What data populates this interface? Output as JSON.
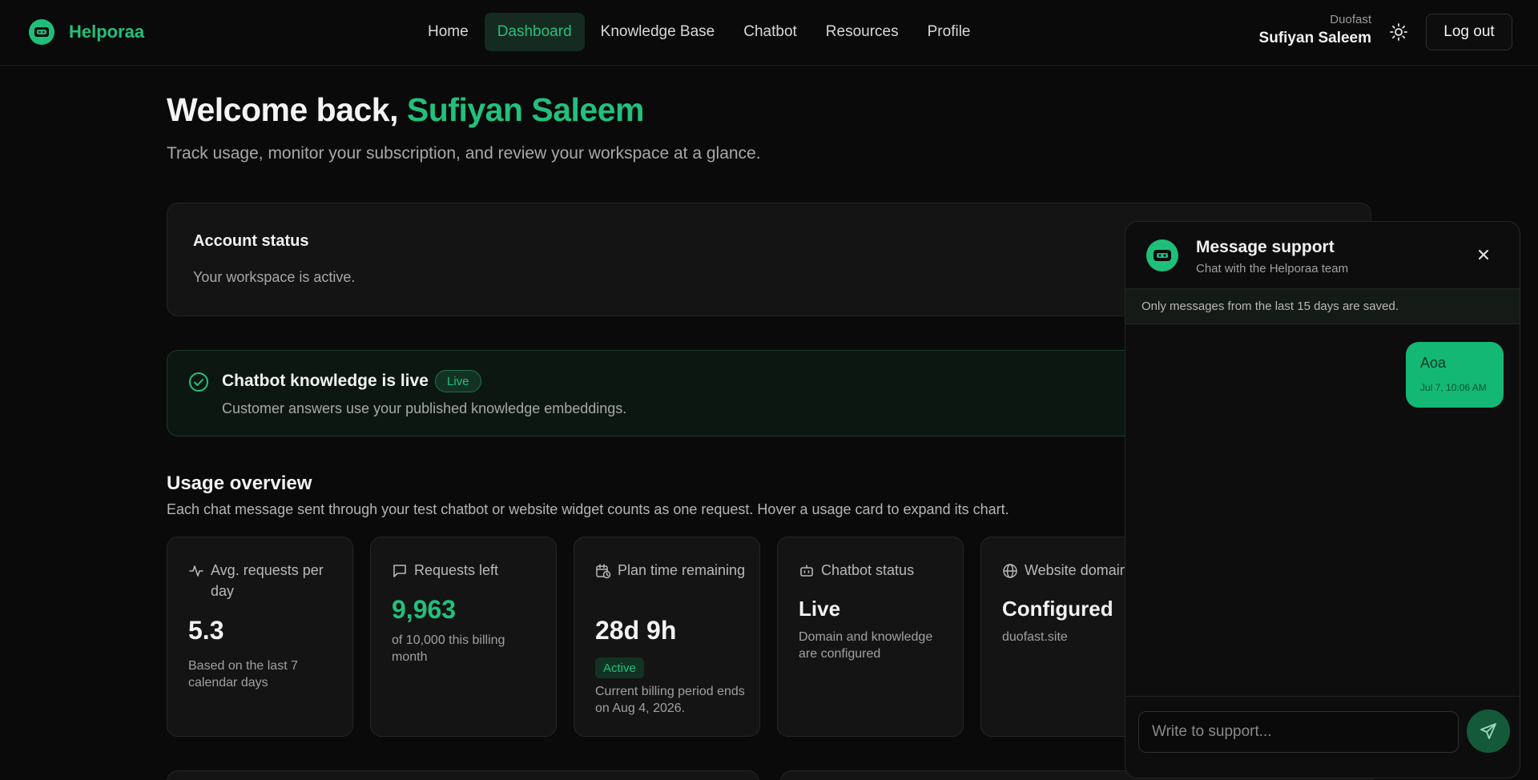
{
  "header": {
    "brand": "Helporaa",
    "nav": [
      {
        "label": "Home",
        "active": false
      },
      {
        "label": "Dashboard",
        "active": true
      },
      {
        "label": "Knowledge Base",
        "active": false
      },
      {
        "label": "Chatbot",
        "active": false
      },
      {
        "label": "Resources",
        "active": false
      },
      {
        "label": "Profile",
        "active": false
      }
    ],
    "org": "Duofast",
    "user_name": "Sufiyan Saleem",
    "theme_icon": "sun-icon",
    "logout_label": "Log out"
  },
  "welcome": {
    "prefix": "Welcome back,",
    "name": "Sufiyan Saleem",
    "subtitle": "Track usage, monitor your subscription, and review your workspace at a glance."
  },
  "account_status": {
    "title": "Account status",
    "description": "Your workspace is active."
  },
  "knowledge": {
    "title": "Chatbot knowledge is live",
    "badge": "Live",
    "description": "Customer answers use your published knowledge embeddings."
  },
  "usage": {
    "title": "Usage overview",
    "description": "Each chat message sent through your test chatbot or website widget counts as one request. Hover a usage card to expand its chart.",
    "cards": [
      {
        "icon": "activity-icon",
        "label": "Avg. requests per day",
        "value": "5.3",
        "sub": "Based on the last 7 calendar days"
      },
      {
        "icon": "message-square-icon",
        "label": "Requests left",
        "value": "9,963",
        "sub": "of 10,000 this billing month"
      },
      {
        "icon": "calendar-clock-icon",
        "label": "Plan time remaining",
        "value": "28d 9h",
        "pill": "Active",
        "sub": "Current billing period ends on Aug 4, 2026."
      },
      {
        "icon": "bot-icon",
        "label": "Chatbot status",
        "value": "Live",
        "sub": "Domain and knowledge are configured"
      },
      {
        "icon": "globe-icon",
        "label": "Website domain",
        "value": "Configured",
        "sub": "duofast.site"
      }
    ]
  },
  "support": {
    "title": "Message support",
    "subtitle": "Chat with the Helporaa team",
    "note": "Only messages from the last 15 days are saved.",
    "messages": [
      {
        "text": "Aoa",
        "time": "Jul 7, 10:06 AM"
      }
    ],
    "input_placeholder": "Write to support...",
    "colors": {
      "accent": "#22c07d",
      "bubble": "#13b874"
    }
  }
}
